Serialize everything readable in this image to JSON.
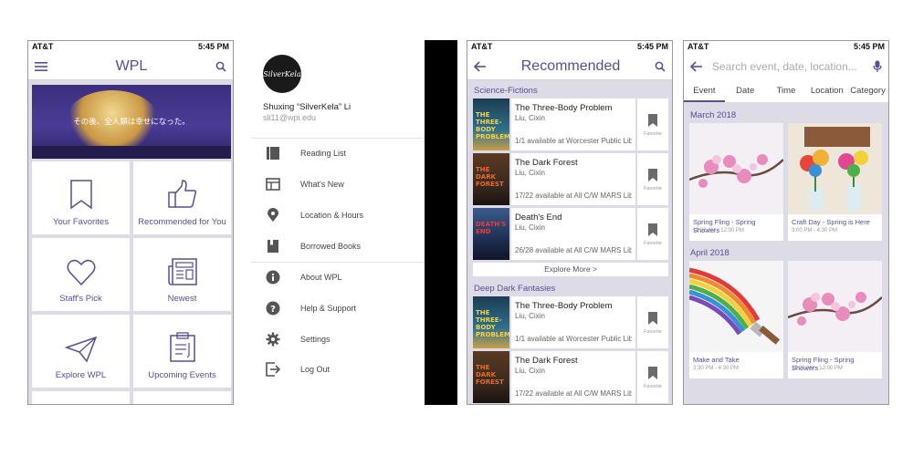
{
  "status": {
    "carrier": "AT&T",
    "time": "5:45 PM"
  },
  "home": {
    "title": "WPL",
    "banner_caption": "その後、全人類は幸せになった。",
    "tiles": [
      {
        "label": "Your Favorites",
        "icon": "bookmark-icon"
      },
      {
        "label": "Recommended for You",
        "icon": "thumbs-up-icon"
      },
      {
        "label": "Staff's Pick",
        "icon": "heart-icon"
      },
      {
        "label": "Newest",
        "icon": "newspaper-icon"
      },
      {
        "label": "Explore WPL",
        "icon": "paper-plane-icon"
      },
      {
        "label": "Upcoming Events",
        "icon": "clipboard-icon"
      }
    ]
  },
  "drawer": {
    "avatar_text": "SilverKela",
    "user_name": "Shuxing “SilverKela” Li",
    "user_email": "sli11@wpi.edu",
    "items": [
      {
        "label": "Reading List",
        "icon": "reading-list-icon"
      },
      {
        "label": "What's New",
        "icon": "news-icon"
      },
      {
        "label": "Location & Hours",
        "icon": "location-pin-icon"
      },
      {
        "label": "Borrowed Books",
        "icon": "book-icon"
      },
      {
        "label": "About WPL",
        "icon": "info-icon"
      },
      {
        "label": "Help & Support",
        "icon": "help-icon"
      },
      {
        "label": "Settings",
        "icon": "gear-icon"
      },
      {
        "label": "Log Out",
        "icon": "logout-icon"
      }
    ]
  },
  "recommended": {
    "title": "Recommended",
    "favorite_label": "Favorite",
    "explore_label": "Explore More >",
    "sections": [
      {
        "name": "Science-Fictions",
        "books": [
          {
            "title": "The Three-Body Problem",
            "author": "Liu, Cixin",
            "availability": "1/1 available at Worcester Public Lib...",
            "cover_text": "THE THREE-BODY PROBLEM",
            "cover_color": "#2f6f8a"
          },
          {
            "title": "The Dark Forest",
            "author": "Liu, Cixin",
            "availability": "17/22 available at All C/W MARS Lib...",
            "cover_text": "THE DARK FOREST",
            "cover_color": "#3a2a1e"
          },
          {
            "title": "Death's End",
            "author": "Liu, Cixin",
            "availability": "26/28 available at All C/W MARS Lib...",
            "cover_text": "DEATH'S END",
            "cover_color": "#1f2f52"
          }
        ]
      },
      {
        "name": "Deep Dark Fantasies",
        "books": [
          {
            "title": "The Three-Body Problem",
            "author": "Liu, Cixin",
            "availability": "1/1 available at Worcester Public Lib...",
            "cover_text": "THE THREE-BODY PROBLEM",
            "cover_color": "#2f6f8a"
          },
          {
            "title": "The Dark Forest",
            "author": "Liu, Cixin",
            "availability": "17/22 available at All C/W MARS Lib...",
            "cover_text": "THE DARK FOREST",
            "cover_color": "#3a2a1e"
          }
        ]
      }
    ]
  },
  "events": {
    "search_placeholder": "Search event, date, location...",
    "tabs": [
      "Event",
      "Date",
      "Time",
      "Location",
      "Category"
    ],
    "months": [
      {
        "name": "March 2018",
        "items": [
          {
            "title": "Spring Fling - Spring Showers",
            "time": "11:00 AM - 12:00 PM",
            "image": "cherry-blossom"
          },
          {
            "title": "Craft Day - Spring is Here",
            "time": "3:00 PM - 4:30 PM",
            "image": "paper-flowers"
          }
        ]
      },
      {
        "name": "April 2018",
        "items": [
          {
            "title": "Make and Take",
            "time": "3:30 PM - 4:30 PM",
            "image": "rainbow-brush"
          },
          {
            "title": "Spring Fling - Spring Showers",
            "time": "11:00 AM - 12:00 PM",
            "image": "cherry-blossom"
          }
        ]
      }
    ]
  },
  "colors": {
    "accent": "#5b4d93",
    "background": "#dddbe6"
  }
}
